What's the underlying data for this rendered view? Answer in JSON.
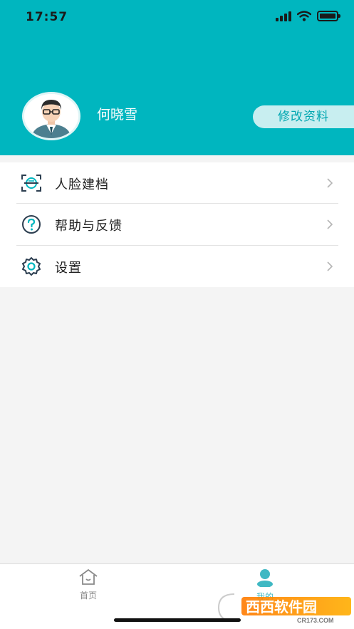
{
  "status_bar": {
    "time": "17:57"
  },
  "profile": {
    "name": "何晓雪",
    "edit_label": "修改资料"
  },
  "menu": {
    "items": [
      {
        "label": "人脸建档",
        "icon": "face-scan-icon"
      },
      {
        "label": "帮助与反馈",
        "icon": "question-icon"
      },
      {
        "label": "设置",
        "icon": "gear-icon"
      }
    ]
  },
  "tabbar": {
    "tabs": [
      {
        "label": "首页",
        "icon": "home-icon",
        "active": false
      },
      {
        "label": "我的",
        "icon": "person-icon",
        "active": true
      }
    ]
  },
  "watermark": {
    "brand": "西西软件园",
    "site": "CR173.COM"
  },
  "colors": {
    "header": "#00b6bf",
    "accent": "#00a7b1",
    "tab_inactive": "#999999",
    "tab_active": "#3fb8c3"
  }
}
